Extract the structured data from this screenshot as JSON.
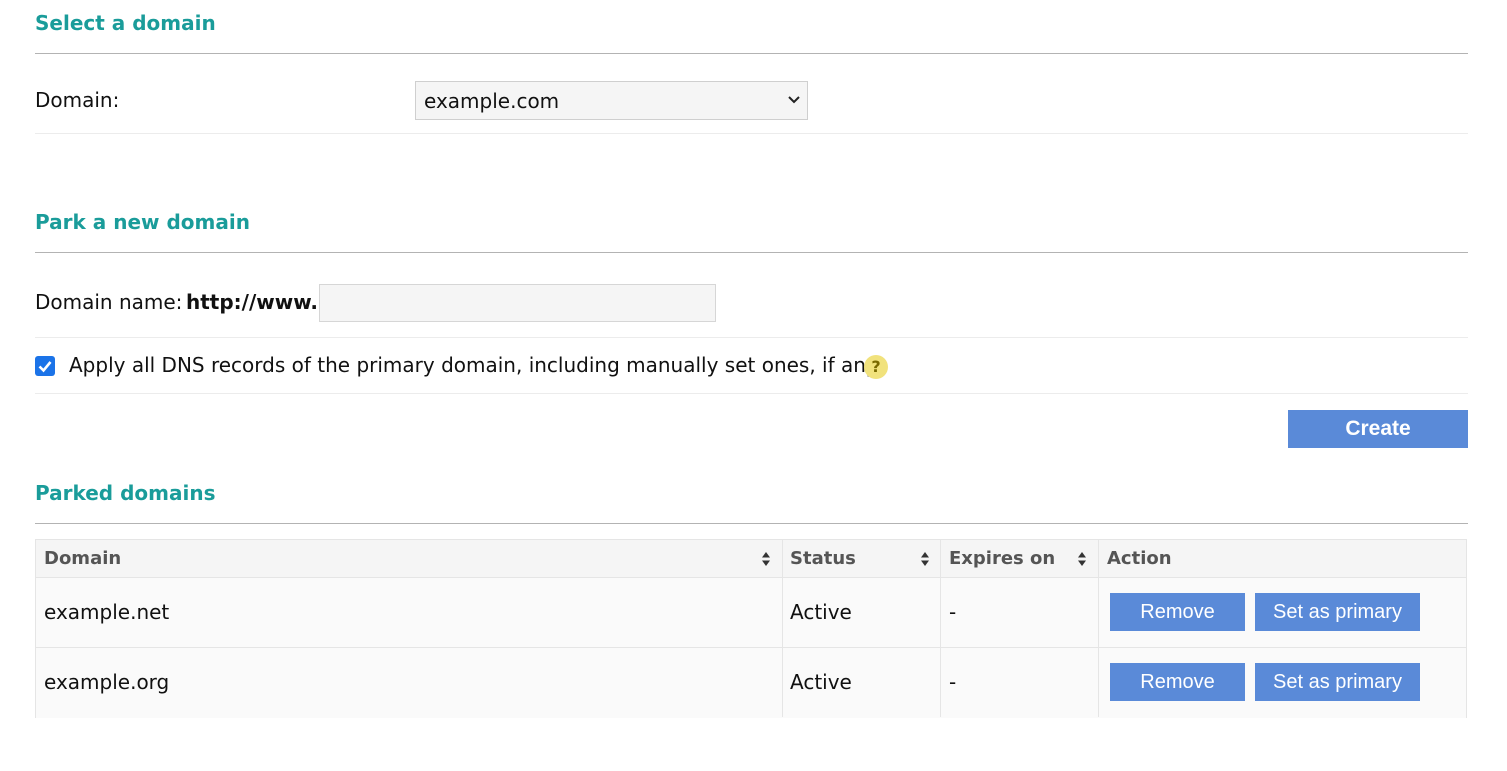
{
  "select_domain": {
    "title": "Select a domain",
    "domain_label": "Domain:",
    "domain_value": "example.com"
  },
  "park": {
    "title": "Park a new domain",
    "name_label": "Domain name:",
    "prefix": "http://www.",
    "input_value": "",
    "dns_checkbox": {
      "checked": true,
      "label": "Apply all DNS records of the primary domain, including manually set ones, if any"
    },
    "help_glyph": "?",
    "create_label": "Create"
  },
  "parked": {
    "title": "Parked domains",
    "columns": [
      "Domain",
      "Status",
      "Expires on",
      "Action"
    ],
    "rows": [
      {
        "domain": "example.net",
        "status": "Active",
        "expires": "-",
        "remove_label": "Remove",
        "primary_label": "Set as primary"
      },
      {
        "domain": "example.org",
        "status": "Active",
        "expires": "-",
        "remove_label": "Remove",
        "primary_label": "Set as primary"
      }
    ]
  },
  "colors": {
    "accent": "#1a9c9a",
    "button": "#5a8ad8",
    "checkbox": "#1b73e8",
    "help_badge": "#f1e27c"
  },
  "icons": {
    "select_chevron": "chevron-down-icon",
    "checkbox": "check-icon",
    "help": "help-icon",
    "sort": "sort-icon"
  }
}
